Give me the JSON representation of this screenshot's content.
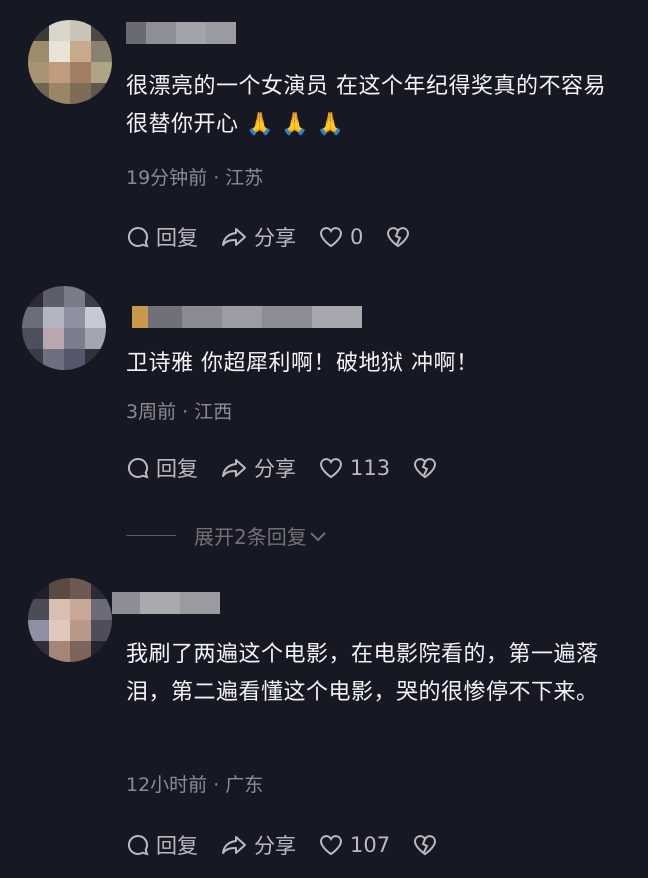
{
  "comments": [
    {
      "text": "很漂亮的一个女演员 在这个年纪得奖真的不容易 很替你开心 🙏 🙏 🙏",
      "meta": "19分钟前 · 江苏",
      "reply_label": "回复",
      "share_label": "分享",
      "likes": "0"
    },
    {
      "text": "卫诗雅 你超犀利啊！破地狱 冲啊！",
      "meta": "3周前 · 江西",
      "reply_label": "回复",
      "share_label": "分享",
      "likes": "113"
    },
    {
      "text": "我刷了两遍这个电影，在电影院看的，第一遍落泪，第二遍看懂这个电影，哭的很惨停不下来。",
      "meta": "12小时前 · 广东",
      "reply_label": "回复",
      "share_label": "分享",
      "likes": "107"
    }
  ],
  "expand_replies": "展开2条回复",
  "icons": [
    "reply-icon",
    "share-icon",
    "heart-icon",
    "broken-heart-icon",
    "chevron-down-icon"
  ],
  "colors": {
    "background": "#161823",
    "text": "#f3f3f5",
    "meta": "#8a8b94"
  }
}
